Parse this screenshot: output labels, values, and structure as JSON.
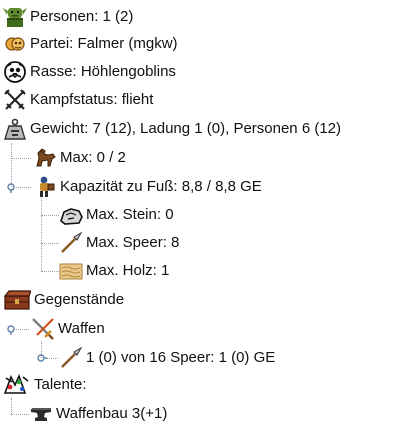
{
  "tree": {
    "persons": "Personen: 1 (2)",
    "party": "Partei: Falmer (mgkw)",
    "race": "Rasse: Höhlengoblins",
    "combat_status": "Kampfstatus: flieht",
    "weight": "Gewicht: 7 (12), Ladung 1 (0), Personen 6 (12)",
    "max_horses": "Max: 0 / 2",
    "capacity_on_foot": "Kapazität zu Fuß: 8,8 / 8,8 GE",
    "max_stone": "Max. Stein: 0",
    "max_spear": "Max. Speer: 8",
    "max_wood": "Max. Holz: 1",
    "items": "Gegenstände",
    "weapons": "Waffen",
    "spear_item": "1 (0) von 16 Speer: 1 (0) GE",
    "talents": "Talente:",
    "weaponcraft": "Waffenbau 3(+1)"
  },
  "colors": {
    "tree_line": "#9aa3ad",
    "handle": "#5a7fa8"
  },
  "icons": [
    "goblin-icon",
    "party-icon",
    "race-icon",
    "crossed-swords-icon",
    "weight-icon",
    "horse-icon",
    "capacity-figure-icon",
    "stone-icon",
    "spear-icon",
    "wood-icon",
    "items-chest-icon",
    "weapons-icon",
    "spear-icon",
    "talents-icon",
    "anvil-icon"
  ]
}
